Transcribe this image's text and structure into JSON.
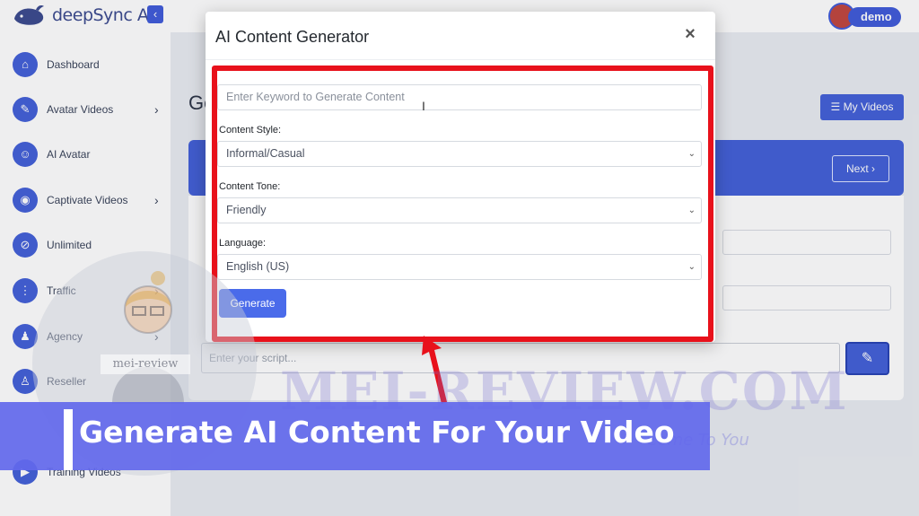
{
  "app": {
    "logo_text": "deepSync AI",
    "collapse_icon": "chevron-left-icon",
    "user_name": "demo"
  },
  "sidebar": {
    "items": [
      {
        "label": "Dashboard",
        "icon": "home-icon",
        "glyph": "⌂",
        "has_arrow": false
      },
      {
        "label": "Avatar Videos",
        "icon": "edit-icon",
        "glyph": "✎",
        "has_arrow": true
      },
      {
        "label": "AI Avatar",
        "icon": "robot-icon",
        "glyph": "☺",
        "has_arrow": false
      },
      {
        "label": "Captivate Videos",
        "icon": "satellite-icon",
        "glyph": "◉",
        "has_arrow": true
      },
      {
        "label": "Unlimited",
        "icon": "ban-icon",
        "glyph": "⊘",
        "has_arrow": false
      },
      {
        "label": "Traffic",
        "icon": "traffic-light-icon",
        "glyph": "⋮",
        "has_arrow": true
      },
      {
        "label": "Agency",
        "icon": "users-icon",
        "glyph": "♟",
        "has_arrow": true
      },
      {
        "label": "Reseller",
        "icon": "user-icon",
        "glyph": "♙",
        "has_arrow": false
      },
      {
        "label": "Training Videos",
        "icon": "video-icon",
        "glyph": "▶",
        "has_arrow": false
      }
    ]
  },
  "main": {
    "title_partial": "Ge",
    "my_videos_label": "☰ My Videos",
    "next_label": "Next ›",
    "script_placeholder": "Enter your script..."
  },
  "modal": {
    "title": "AI Content Generator",
    "close_glyph": "×",
    "keyword_placeholder": "Enter Keyword to Generate Content",
    "content_style_label": "Content Style:",
    "content_style_value": "Informal/Casual",
    "content_tone_label": "Content Tone:",
    "content_tone_value": "Friendly",
    "language_label": "Language:",
    "language_value": "English (US)",
    "generate_label": "Generate"
  },
  "overlay": {
    "caption": "Generate AI Content For Your Video",
    "watermark_text": "MEI-REVIEW.COM",
    "watermark_tagline": "Come To You",
    "watermark_badge": "mei-review",
    "highlight_color": "#e8111b",
    "banner_color": "#6268ec"
  }
}
